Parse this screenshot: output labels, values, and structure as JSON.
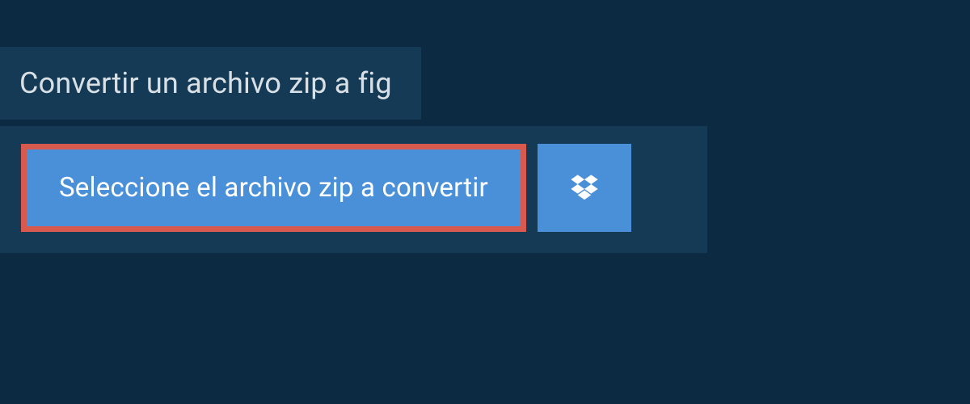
{
  "header": {
    "title": "Convertir un archivo zip a fig"
  },
  "actions": {
    "select_file_label": "Seleccione el archivo zip a convertir",
    "cloud_provider_icon": "dropbox-icon"
  },
  "colors": {
    "page_bg": "#0c2a42",
    "panel_bg": "#153a56",
    "button_bg": "#4a90d9",
    "highlight_border": "#d85a4f",
    "text_light": "#ffffff",
    "text_header": "#d8e0e6"
  }
}
